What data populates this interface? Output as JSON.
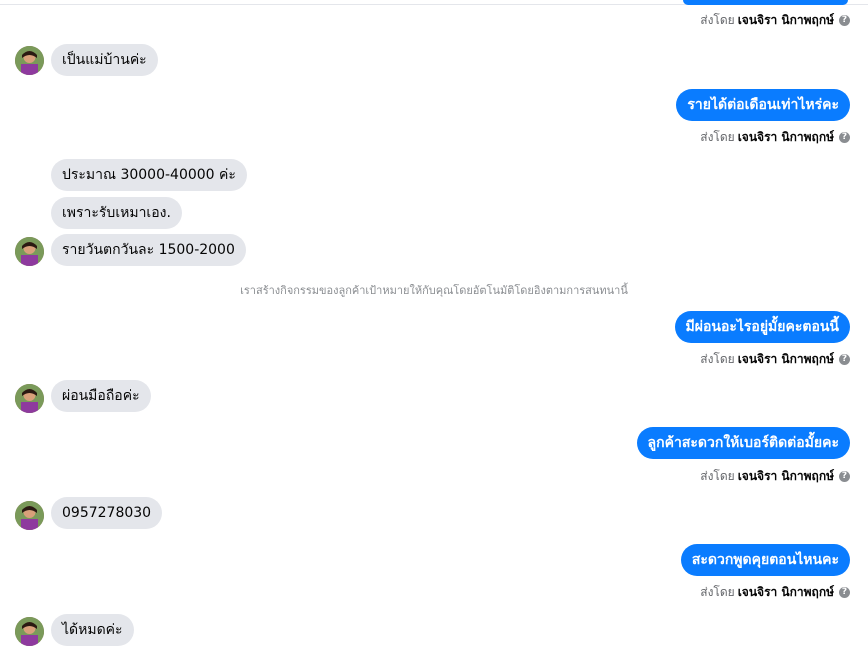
{
  "sent_by_prefix": "ส่งโดย",
  "sent_by_name": "เจนจิรา นิกาพฤกษ์",
  "info_icon": "question-circle-icon",
  "notice": "เราสร้างกิจกรรมของลูกค้าเป้าหมายให้กับคุณโดยอัตโนมัติโดยอิงตามการสนทนานี้",
  "messages": [
    {
      "side": "in",
      "text": "เป็นแม่บ้านค่ะ"
    },
    {
      "side": "out",
      "text": "รายได้ต่อเดือนเท่าไหร่คะ"
    },
    {
      "side": "in",
      "text": "ประมาณ 30000-40000 ค่ะ"
    },
    {
      "side": "in",
      "text": "เพราะรับเหมาเอง."
    },
    {
      "side": "in",
      "text": "รายวันตกวันละ 1500-2000"
    },
    {
      "side": "out",
      "text": "มีผ่อนอะไรอยู่มั้ยคะตอนนี้"
    },
    {
      "side": "in",
      "text": "ผ่อนมือถือค่ะ"
    },
    {
      "side": "out",
      "text": "ลูกค้าสะดวกให้เบอร์ติดต่อมั้ยคะ"
    },
    {
      "side": "in",
      "text": "0957278030"
    },
    {
      "side": "out",
      "text": "สะดวกพูดคุยตอนไหนคะ"
    },
    {
      "side": "in",
      "text": "ได้หมดค่ะ"
    }
  ],
  "colors": {
    "outgoing_bubble": "#0a7cff",
    "incoming_bubble": "#e4e6eb",
    "meta_text": "#65676b"
  }
}
